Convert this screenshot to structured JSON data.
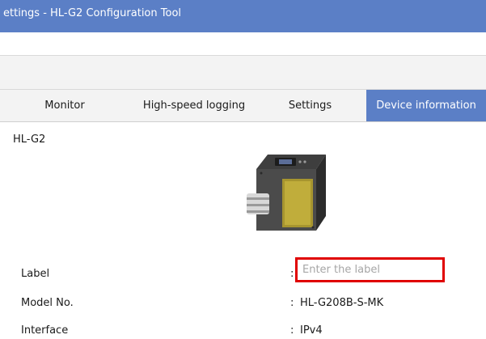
{
  "window": {
    "title": "ettings - HL-G2 Configuration Tool"
  },
  "tabs": [
    {
      "label": "Monitor",
      "active": false
    },
    {
      "label": "High-speed logging",
      "active": false
    },
    {
      "label": "Settings",
      "active": false
    },
    {
      "label": "Device information",
      "active": true
    }
  ],
  "device": {
    "name": "HL-G2",
    "image_icon": "laser-sensor-icon",
    "label": {
      "title": "Label",
      "colon": ":",
      "value": "",
      "placeholder": "Enter the label"
    },
    "model": {
      "title": "Model No.",
      "colon": ":",
      "value": "HL-G208B-S-MK"
    },
    "interface": {
      "title": "Interface",
      "colon": ":",
      "value": "IPv4"
    }
  },
  "colors": {
    "accent": "#5b7fc6",
    "highlight_border": "#e00000",
    "chrome_background": "#f3f3f3"
  }
}
